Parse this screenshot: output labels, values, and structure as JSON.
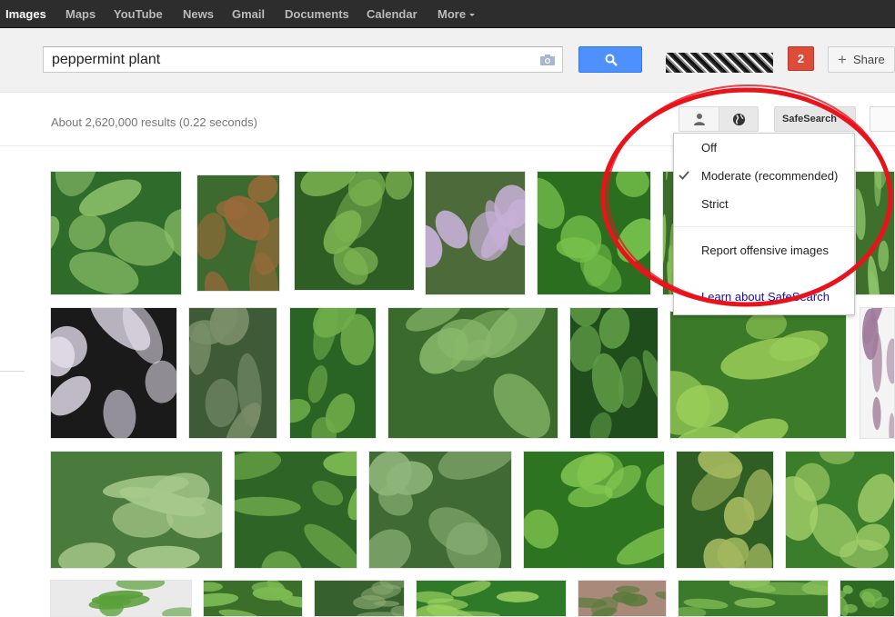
{
  "nav": {
    "items": [
      {
        "label": "Images"
      },
      {
        "label": "Maps"
      },
      {
        "label": "YouTube"
      },
      {
        "label": "News"
      },
      {
        "label": "Gmail"
      },
      {
        "label": "Documents"
      },
      {
        "label": "Calendar"
      },
      {
        "label": "More"
      }
    ],
    "active": "Images"
  },
  "search": {
    "query": "peppermint plant"
  },
  "header": {
    "notification_count": "2",
    "share_label": "Share"
  },
  "results": {
    "stats": "About 2,620,000 results (0.22 seconds)"
  },
  "toolbar": {
    "safesearch_label": "SafeSearch"
  },
  "safesearch_menu": {
    "off": "Off",
    "moderate": "Moderate (recommended)",
    "strict": "Strict",
    "selected": "Moderate (recommended)",
    "report": "Report offensive images",
    "learn": "Learn about SafeSearch"
  },
  "thumbnails": {
    "count": 31,
    "subject": "peppermint plant images"
  },
  "colors": {
    "topbar": "#2d2d2d",
    "header": "#f1f1f1",
    "search_button": "#4d90fe",
    "notification": "#dd4b39",
    "highlight_ellipse": "#e8131b",
    "link": "#1a0dab"
  }
}
